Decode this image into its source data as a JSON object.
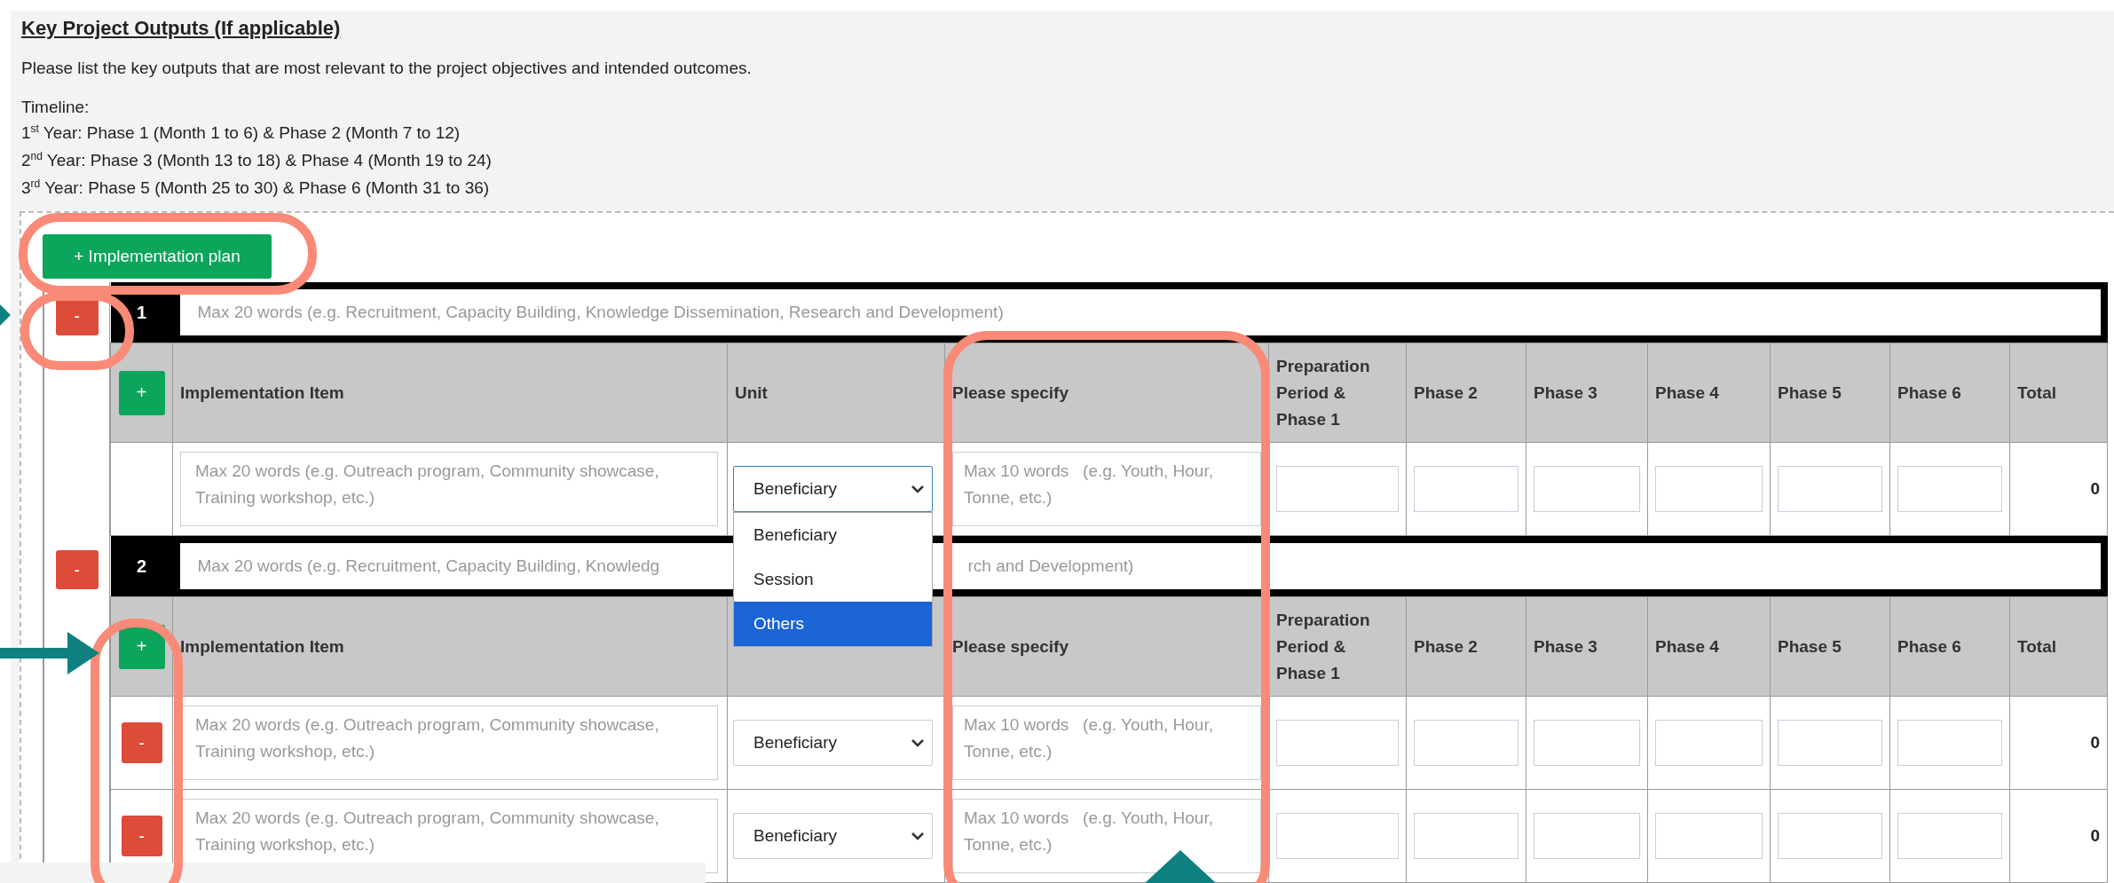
{
  "section": {
    "title": "Key Project Outputs (If applicable)",
    "description": "Please list the key outputs that are most relevant to the project objectives and intended outcomes.",
    "timeline_label": "Timeline:",
    "timeline": [
      "1$^{st}$ Year: Phase 1 (Month 1 to 6) & Phase 2 (Month 7 to 12)",
      "2$^{nd}$ Year: Phase 3 (Month 13 to 18) & Phase 4 (Month 19 to 24)",
      "3$^{rd}$ Year: Phase 5 (Month 25 to 30) & Phase 6 (Month 31 to 36)"
    ]
  },
  "add_plan_button": "+ Implementation plan",
  "unit_options": [
    {
      "label": "Beneficiary",
      "selected": false
    },
    {
      "label": "Session",
      "selected": false
    },
    {
      "label": "Others",
      "selected": true
    }
  ],
  "blocks": [
    {
      "remove_label": "-",
      "number": "1",
      "output_placeholder": [
        "Max 20 words (e.g. Recruitment, Capacity Building, Knowledge Dissemination, Research and Development)"
      ],
      "add_label": "+",
      "columns": [
        "Implementation Item",
        "Unit",
        "Please specify",
        "Preparation Period & Phase 1",
        "Phase 2",
        "Phase 3",
        "Phase 4",
        "Phase 5",
        "Phase 6",
        "Total"
      ],
      "rows": [
        {
          "removable": false,
          "item_placeholder": "Max 20 words (e.g. Outreach program, Community showcase, Training workshop, etc.)",
          "unit": "Beneficiary",
          "open": true,
          "specify_placeholder": "Max 10 words   (e.g. Youth, Hour, Tonne, etc.)",
          "total": "0"
        }
      ]
    },
    {
      "remove_label": "-",
      "number": "2",
      "output_placeholder": [
        "Max 20 words (e.g. Recruitment, Capacity Building, Knowledg",
        "rch and Development)"
      ],
      "add_label": "+",
      "columns": [
        "Implementation Item",
        null,
        "Please specify",
        "Preparation Period & Phase 1",
        "Phase 2",
        "Phase 3",
        "Phase 4",
        "Phase 5",
        "Phase 6",
        "Total"
      ],
      "rows": [
        {
          "removable": true,
          "remove_label": "-",
          "item_placeholder": "Max 20 words (e.g. Outreach program, Community showcase, Training workshop, etc.)",
          "unit": "Beneficiary",
          "open": false,
          "specify_placeholder": "Max 10 words   (e.g. Youth, Hour, Tonne, etc.)",
          "total": "0"
        },
        {
          "removable": true,
          "remove_label": "-",
          "item_placeholder": "Max 20 words (e.g. Outreach program, Community showcase, Training workshop, etc.)",
          "unit": "Beneficiary",
          "open": false,
          "specify_placeholder": "Max 10 words   (e.g. Youth, Hour, Tonne, etc.)",
          "total": "0"
        }
      ]
    }
  ]
}
